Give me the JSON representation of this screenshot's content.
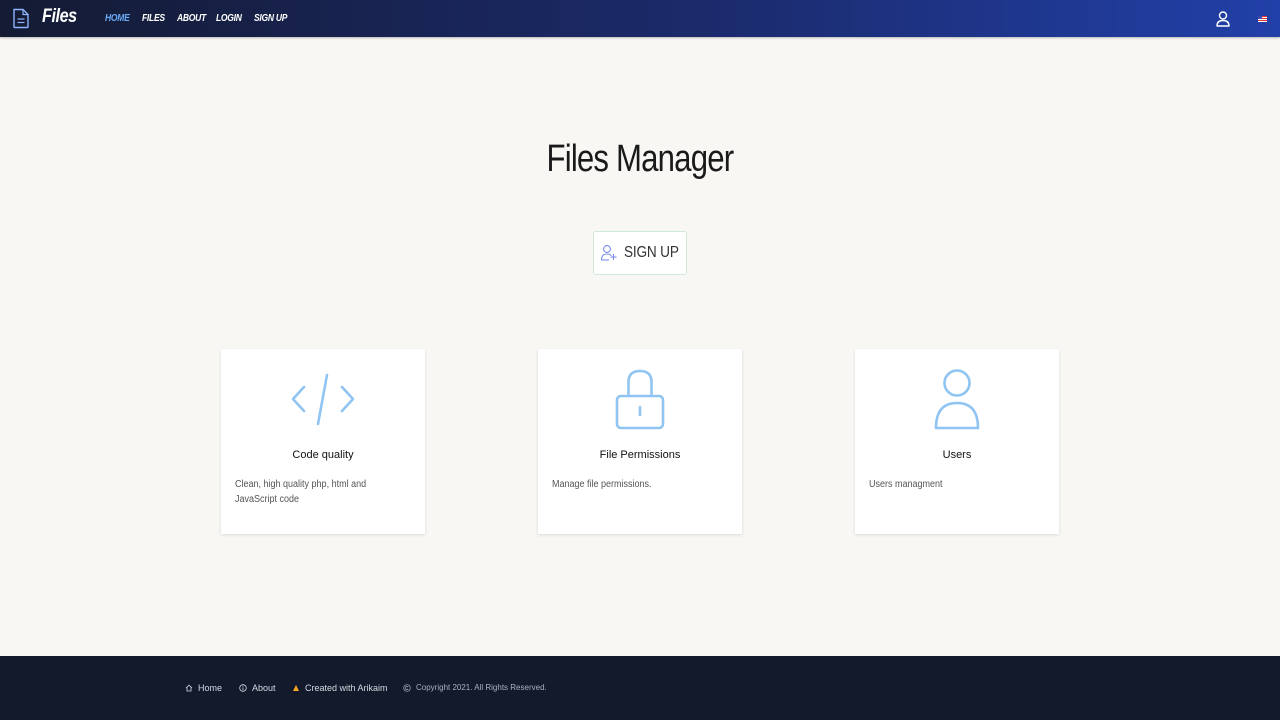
{
  "header": {
    "logo_text": "Files",
    "nav": [
      "HOME",
      "FILES",
      "ABOUT",
      "LOGIN",
      "SIGN UP"
    ],
    "active_nav": "HOME"
  },
  "hero": {
    "title": "Files Manager",
    "signup_label": "SIGN UP"
  },
  "cards": [
    {
      "title": "Code quality",
      "text": "Clean, high quality php, html and JavaScript code",
      "icon": "code-icon"
    },
    {
      "title": "File Permissions",
      "text": "Manage file permissions.",
      "icon": "lock-icon"
    },
    {
      "title": "Users",
      "text": "Users managment",
      "icon": "user-icon"
    }
  ],
  "footer": {
    "home": "Home",
    "about": "About",
    "created": "Created with Arikaim",
    "copyright": "Copyright 2021. All Rights Reserved."
  },
  "colors": {
    "accent": "#6aa9f5",
    "icon": "#90c4f2",
    "footer_bg": "#131a2c"
  }
}
